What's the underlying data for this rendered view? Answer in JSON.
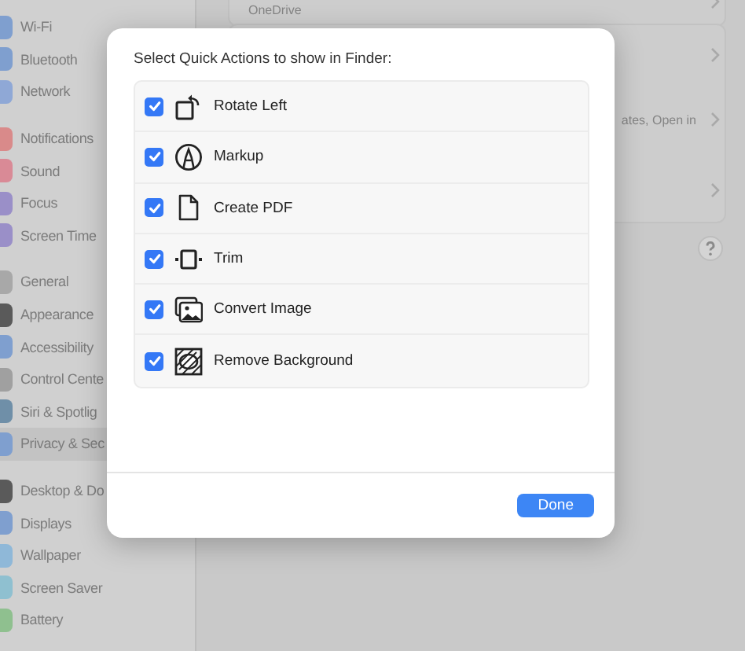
{
  "sidebar": {
    "groups": [
      [
        {
          "label": "Wi-Fi",
          "color": "#7f9fcf",
          "selected": false
        },
        {
          "label": "Bluetooth",
          "color": "#7f9fcf",
          "selected": false
        },
        {
          "label": "Network",
          "color": "#8fa8d6",
          "selected": false
        }
      ],
      [
        {
          "label": "Notifications",
          "color": "#d98a8a",
          "selected": false
        },
        {
          "label": "Sound",
          "color": "#d98a96",
          "selected": false
        },
        {
          "label": "Focus",
          "color": "#9a8fc8",
          "selected": false
        },
        {
          "label": "Screen Time",
          "color": "#9a8fc8",
          "selected": false
        }
      ],
      [
        {
          "label": "General",
          "color": "#a8a8a8",
          "selected": false
        },
        {
          "label": "Appearance",
          "color": "#5a5a5a",
          "selected": false
        },
        {
          "label": "Accessibility",
          "color": "#7f9fcf",
          "selected": false
        },
        {
          "label": "Control Cente",
          "color": "#a0a0a0",
          "selected": false
        },
        {
          "label": "Siri & Spotlig",
          "color": "#6f8fa8",
          "selected": false
        },
        {
          "label": "Privacy & Sec",
          "color": "#7f9fcf",
          "selected": true
        }
      ],
      [
        {
          "label": "Desktop & Do",
          "color": "#5a5a5a",
          "selected": false
        },
        {
          "label": "Displays",
          "color": "#7f9fcf",
          "selected": false
        },
        {
          "label": "Wallpaper",
          "color": "#8fb8d8",
          "selected": false
        },
        {
          "label": "Screen Saver",
          "color": "#8fc0d0",
          "selected": false
        },
        {
          "label": "Battery",
          "color": "#8fc08f",
          "selected": false
        }
      ]
    ]
  },
  "background": {
    "top_label": "OneDrive",
    "cut_label": "ates, Open in"
  },
  "dialog": {
    "title": "Select Quick Actions to show in Finder:",
    "actions": [
      {
        "label": "Rotate Left",
        "kind": "rotate",
        "checked": true
      },
      {
        "label": "Markup",
        "kind": "markup",
        "checked": true
      },
      {
        "label": "Create PDF",
        "kind": "pdf",
        "checked": true
      },
      {
        "label": "Trim",
        "kind": "trim",
        "checked": true
      },
      {
        "label": "Convert Image",
        "kind": "convert",
        "checked": true
      },
      {
        "label": "Remove Background",
        "kind": "remove-bg",
        "checked": true
      }
    ],
    "button": "Done"
  }
}
